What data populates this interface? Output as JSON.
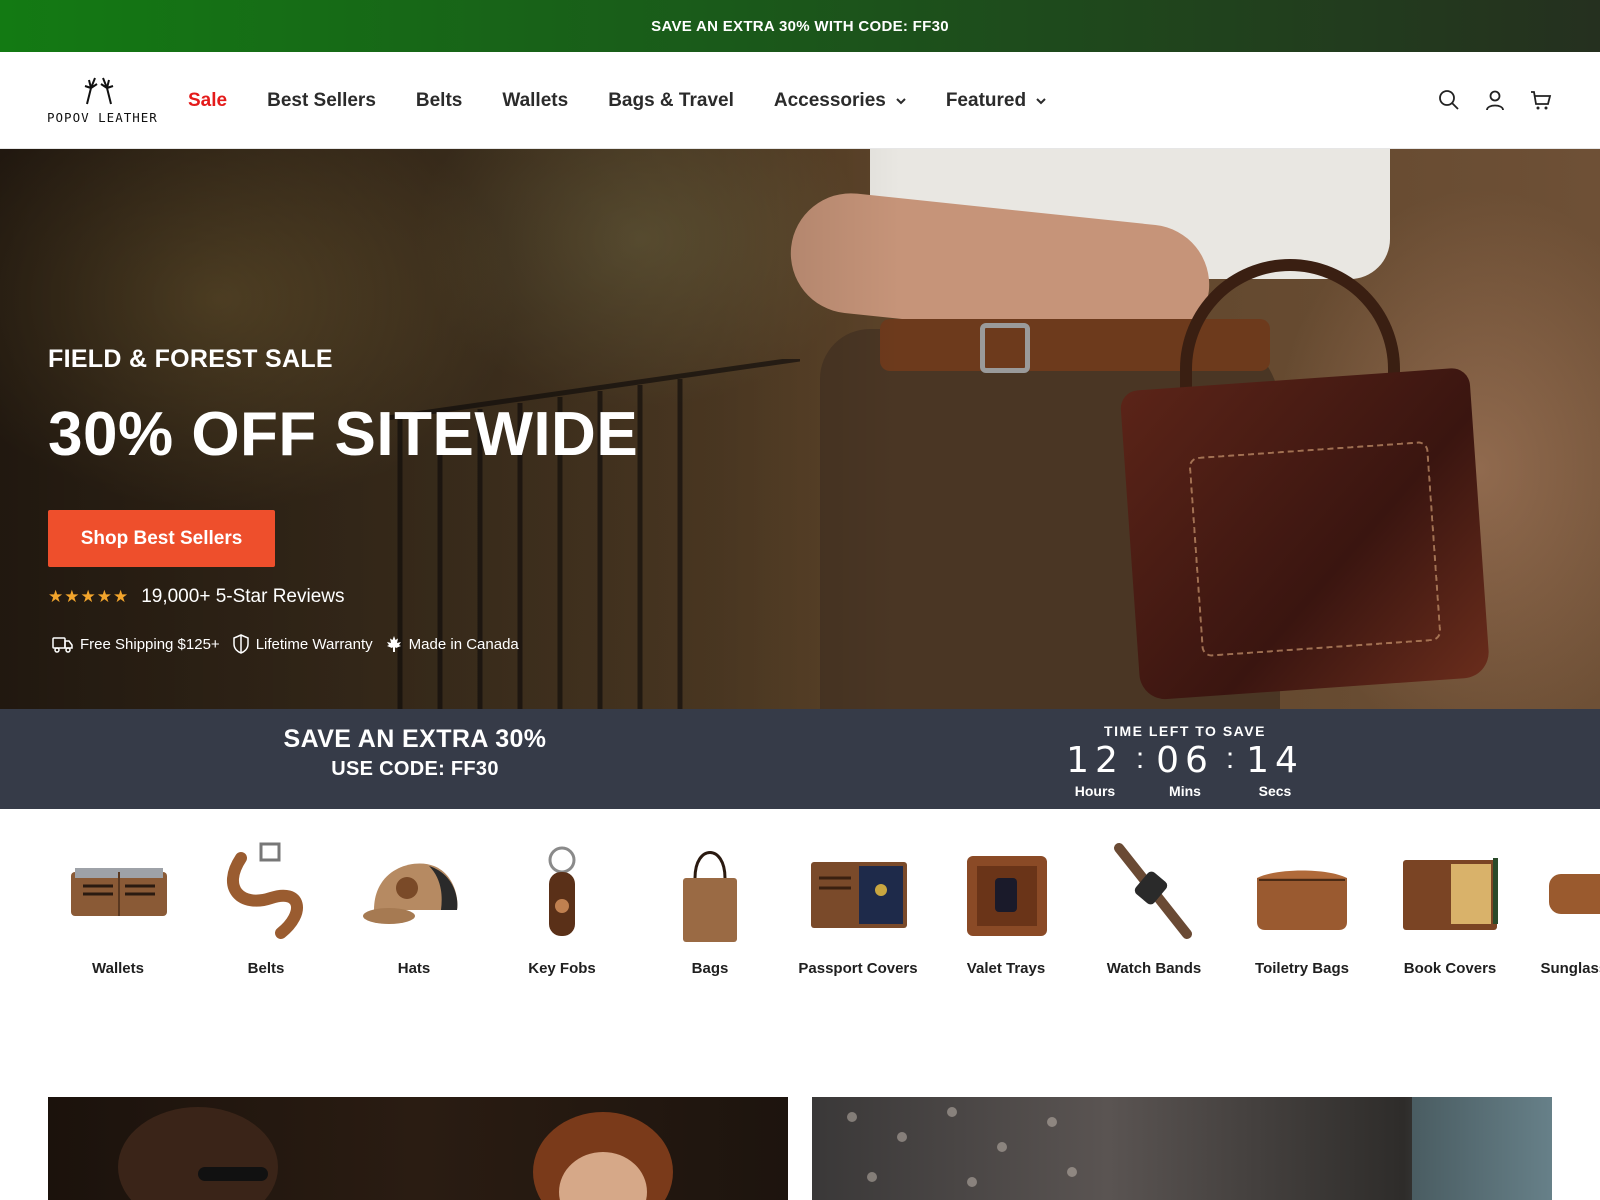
{
  "announcement": {
    "text": "SAVE AN EXTRA 30% WITH CODE: FF30"
  },
  "brand": {
    "logo_text": "POPOV LEATHER"
  },
  "nav": {
    "items": [
      {
        "label": "Sale"
      },
      {
        "label": "Best Sellers"
      },
      {
        "label": "Belts"
      },
      {
        "label": "Wallets"
      },
      {
        "label": "Bags & Travel"
      },
      {
        "label": "Accessories"
      },
      {
        "label": "Featured"
      }
    ]
  },
  "header_icons": [
    "search-icon",
    "account-icon",
    "cart-icon"
  ],
  "hero": {
    "eyebrow": "FIELD & FOREST SALE",
    "headline": "30% OFF SITEWIDE",
    "cta_label": "Shop Best Sellers",
    "stars": "★★★★★",
    "reviews_text": "19,000+ 5-Star Reviews",
    "perks": [
      {
        "icon": "truck-icon",
        "label": "Free Shipping $125+"
      },
      {
        "icon": "shield-icon",
        "label": "Lifetime Warranty"
      },
      {
        "icon": "maple-leaf-icon",
        "label": "Made in Canada"
      }
    ]
  },
  "promo": {
    "line1": "SAVE AN EXTRA 30%",
    "line2": "USE CODE: FF30",
    "timer_label": "TIME LEFT TO SAVE",
    "hours": "12",
    "mins": "06",
    "secs": "14",
    "hours_label": "Hours",
    "mins_label": "Mins",
    "secs_label": "Secs",
    "separator": ":"
  },
  "categories": [
    {
      "label": "Wallets"
    },
    {
      "label": "Belts"
    },
    {
      "label": "Hats"
    },
    {
      "label": "Key Fobs"
    },
    {
      "label": "Bags"
    },
    {
      "label": "Passport Covers"
    },
    {
      "label": "Valet Trays"
    },
    {
      "label": "Watch Bands"
    },
    {
      "label": "Toiletry Bags"
    },
    {
      "label": "Book Covers"
    },
    {
      "label": "Sunglass Cases"
    }
  ],
  "colors": {
    "accent_cta": "#ee4f2c",
    "sale_red": "#e41b1b",
    "promo_bg": "#363b48",
    "star": "#f3a52c"
  }
}
